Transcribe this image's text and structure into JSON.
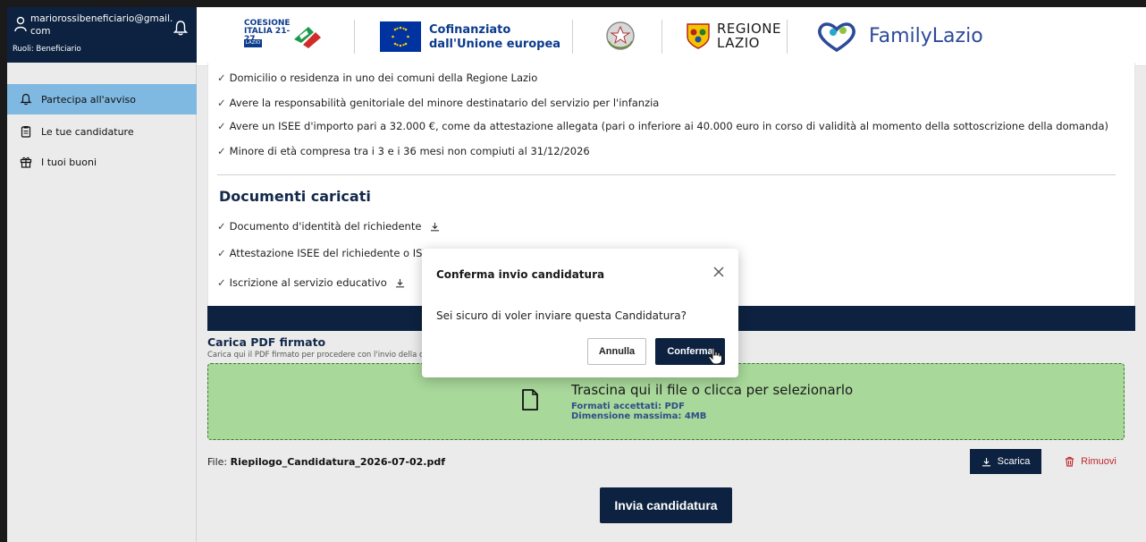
{
  "user": {
    "email": "mariorossibeneficiario@gmail.com",
    "role": "Ruoli: Beneficiario"
  },
  "sidebar": {
    "items": [
      {
        "label": "Partecipa all'avviso",
        "icon": "bell-icon",
        "active": true
      },
      {
        "label": "Le tue candidature",
        "icon": "clipboard-icon",
        "active": false
      },
      {
        "label": "I tuoi buoni",
        "icon": "gift-icon",
        "active": false
      }
    ]
  },
  "header": {
    "coesione_text": "COESIONE ITALIA 21-27",
    "coesione_badge": "LAZIO",
    "eu_text_line1": "Cofinanziato",
    "eu_text_line2": "dall'Unione europea",
    "regione_line1": "REGIONE",
    "regione_line2": "LAZIO",
    "family_text": "FamilyLazio"
  },
  "requirements": [
    "Domicilio o residenza in uno dei comuni della Regione Lazio",
    "Avere la responsabilità genitoriale del minore destinatario del servizio per l'infanzia",
    "Avere un ISEE d'importo pari a 32.000 €, come da attestazione allegata (pari o inferiore ai 40.000 euro in corso di validità al momento della sottoscrizione della domanda)",
    "Minore di età compresa tra i 3 e i 36 mesi non compiuti al 31/12/2026"
  ],
  "documents": {
    "title": "Documenti caricati",
    "items": [
      "Documento d'identità del richiedente",
      "Attestazione ISEE del richiedente o ISEE minorenni in caso di genitori non conviventi",
      "Iscrizione al servizio educativo"
    ]
  },
  "upload": {
    "title": "Carica PDF firmato",
    "subtitle": "Carica qui il PDF firmato per procedere con l'invio della candidatura",
    "dropzone_main": "Trascina qui il file o clicca per selezionarlo",
    "dropzone_formats": "Formati accettati: PDF",
    "dropzone_size": "Dimensione massima: 4MB",
    "file_label": "File:",
    "file_name": "Riepilogo_Candidatura_2026-07-02.pdf",
    "download_label": "Scarica",
    "remove_label": "Rimuovi",
    "submit_label": "Invia candidatura"
  },
  "modal": {
    "title": "Conferma invio candidatura",
    "body": "Sei sicuro di voler inviare questa Candidatura?",
    "cancel_label": "Annulla",
    "confirm_label": "Conferma"
  },
  "colors": {
    "navy": "#0d2240",
    "active_sidebar": "#7fb8e0",
    "dropzone": "#a8d89a",
    "danger": "#c0282d"
  }
}
